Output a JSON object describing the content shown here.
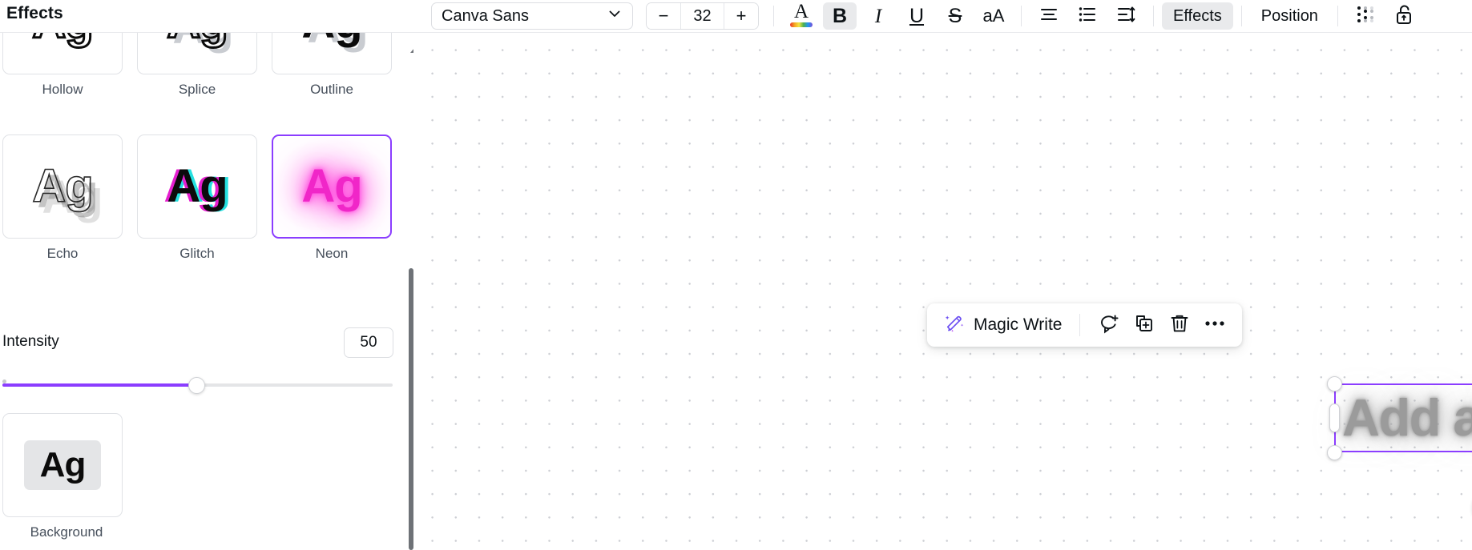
{
  "panel": {
    "title": "Effects",
    "effects_row1": [
      {
        "label": "Hollow",
        "style": "hollow",
        "sample": "Ag",
        "selected": false
      },
      {
        "label": "Splice",
        "style": "splice",
        "sample": "Ag",
        "selected": false
      },
      {
        "label": "Outline",
        "style": "outline",
        "sample": "Ag",
        "selected": false
      }
    ],
    "effects_row2": [
      {
        "label": "Echo",
        "style": "echo",
        "sample": "Ag",
        "selected": false
      },
      {
        "label": "Glitch",
        "style": "glitch",
        "sample": "Ag",
        "selected": false
      },
      {
        "label": "Neon",
        "style": "neon",
        "sample": "Ag",
        "selected": true
      }
    ],
    "intensity": {
      "label": "Intensity",
      "value": "50",
      "percent": 50
    },
    "background": {
      "label": "Background",
      "sample": "Ag"
    }
  },
  "toolbar": {
    "font_family": "Canva Sans",
    "font_size": "32",
    "decrease_label": "−",
    "increase_label": "+",
    "bold_label": "B",
    "italic_label": "I",
    "underline_label": "U",
    "strikethrough_label": "S",
    "case_label": "aA",
    "effects_label": "Effects",
    "position_label": "Position",
    "text_color_letter": "A"
  },
  "element_toolbar": {
    "magic_write_label": "Magic Write"
  },
  "canvas": {
    "heading_text": "Add a heading"
  },
  "colors": {
    "accent_purple": "#8b3dff",
    "neon_pink": "#f026c8",
    "glitch_cyan": "#25e0e0",
    "glitch_magenta": "#e51fcf",
    "panel_border": "#e0e2e6",
    "text_primary": "#0d1216",
    "text_secondary": "#464f5b",
    "heading_gray": "#9b9b9b"
  }
}
